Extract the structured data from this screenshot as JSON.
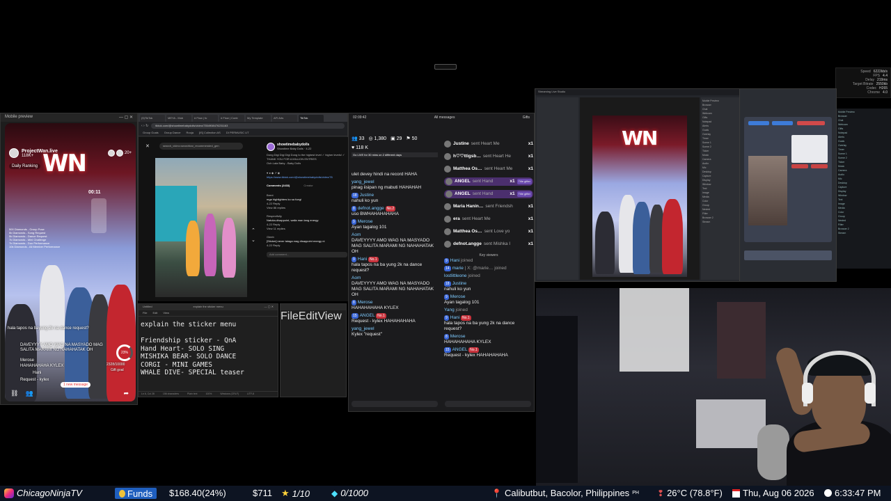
{
  "stats": {
    "rows": [
      {
        "label": "Speed",
        "value": "6222kb/s"
      },
      {
        "label": "FPS",
        "value": "4.4"
      },
      {
        "label": "Delay",
        "value": "219ms"
      },
      {
        "label": "Target Bitrate",
        "value": "2550kb"
      },
      {
        "label": "Codec",
        "value": "H265"
      },
      {
        "label": "Chrome",
        "value": "4.0"
      }
    ]
  },
  "mobile": {
    "title": "Mobile preview",
    "host_name": "ProjectWan.live",
    "host_likes": "118K+",
    "viewer_count": "20+",
    "daily_ranking": "Daily Ranking",
    "logo": "WN",
    "timer": "00:11",
    "goals": [
      "500 Diamonds - Group Pose",
      "5k Diamonds - Song Request",
      "5k Diamonds - Dance Request",
      "7k Diamonds - Mini Challenge",
      "7k Diamonds - Duo Performance",
      "10k Diamonds - All Member Performance"
    ],
    "comment_top": "hala tapos na bayung 2k na dance request?",
    "comment_1": "DAVEYYYY AMO WAG NA MASYADO MAG SALITA MARAMI NG NAHAHATAK OH",
    "comment_2_user": "Merose",
    "comment_2": "HAHAHAHAHA KYLEX",
    "comment_3_user": "Hani",
    "comment_3": "Request - kylex",
    "goal_percent": "23%",
    "goal_count": "2328",
    "goal_total": "/10000",
    "gift_goal": "Gift goal",
    "new_message": "1 new message"
  },
  "browser": {
    "tabs": [
      "(5)TikTok",
      "MEYA - Mob",
      "# Flow | fo",
      "# Flow | Contr",
      "My Template",
      "AFI Arts",
      "TikTok"
    ],
    "url": "tiktok.com/@showtimebabydolls/video/7354908476231163",
    "bookmarks": [
      "Group Goals",
      "Group Dance",
      "Rooja",
      "[IS] Collection AS",
      "DI PERMUSIC UT"
    ],
    "search": "search_video=searchbar_recommended_gen",
    "author": "showtimebabydolls",
    "author_sub": "Showtime Baby Dolls · 4-22",
    "caption": "Dong Digi Digi Digi Dong to the highest level ✓ higher levels! ✓ THANK YOU FOR A MILLION ENTRIES",
    "sound": "Ooh Lala Baby - Baby Dolls",
    "link": "https://www.tiktok.com/@showtimebabydolls/video/76",
    "comments_header": "Comments (2433)",
    "creator_tab": "Creator",
    "c1_user": "Brent",
    "c1_text": "mga highlighters ko sa fuegi",
    "c1_meta": "4-22 Reply",
    "c1_more": "View 86 replies",
    "c2_user": "Respectfully",
    "c2_text": "Natuka-disappoint, walla man lang energy",
    "c2_meta": "4-22 Reply",
    "c2_more": "View 11 replies",
    "c3_user": "Gleeb",
    "c3_text": "[Sticker] never talaga mag disappoint energy ni",
    "c3_meta": "4-22 Reply",
    "add_comment": "Add comment..."
  },
  "notepad": {
    "title": "Untitled",
    "tab": "explain the sticker menu",
    "menu": [
      "File",
      "Edit",
      "View"
    ],
    "lines": [
      "explain the sticker menu",
      "",
      "Friendship sticker - QnA",
      "Hand Heart- SOLO SING",
      "MISHIKA BEAR- SOLO DANCE",
      "CORGI - MINI GAMES",
      "WHALE DIVE- SPECIAL teaser"
    ],
    "status": [
      "Ln 6, Col 28",
      "156 characters",
      "Plain text",
      "100%",
      "Windows (CRLF)",
      "UTF-8"
    ]
  },
  "chat": {
    "clock": "02:09:42",
    "all_messages": "All messages",
    "gifts": "Gifts",
    "viewers": "33",
    "coins": "1,380",
    "shares": "29",
    "gifters": "50",
    "likes": "118 K",
    "live_banner": "Go LIVE for 30 mins on 2 different days",
    "left_messages": [
      {
        "user": "",
        "text": "ulet devey hindi na record HAHA"
      },
      {
        "user": "yang_jewel",
        "text": "pinag iisipan ng mabuti HAHAHAH"
      },
      {
        "user": "Justine",
        "lvl": "18",
        "text": "nahuli ko yun"
      },
      {
        "user": "defnot.angge",
        "lvl": "8",
        "badge": "No.2",
        "text": "uso BWHAHAHAHAHA"
      },
      {
        "user": "Merose",
        "lvl": "9",
        "text": "Ayan tagalog 101"
      },
      {
        "user": "Aom",
        "text": "DAVEYYYY AMO WAG NA MASYADO MAG SALITA MARAMI NG NAHAHATAK OH"
      },
      {
        "user": "Hani",
        "lvl": "9",
        "badge": "No.1",
        "text": "hala tapos na ba yung 2k na dance request?"
      },
      {
        "user": "Aom",
        "text": "DAVEYYYY AMO WAG NA MASYADO MAG SALITA MARAMI NG NAHAHATAK OH"
      },
      {
        "user": "Merose",
        "lvl": "8",
        "text": "HAHAHAHAHA KYLEX"
      },
      {
        "user": "ANGEL",
        "lvl": "15",
        "badge": "No.1",
        "text": "Request - kylex HAHAHAHAHA"
      },
      {
        "user": "yang_jewel",
        "text": "Kylex \"request\""
      }
    ],
    "gift_rows": [
      {
        "name": "Justine",
        "text": "sent Heart Me",
        "x": "x1",
        "hl": false
      },
      {
        "name": "h♡♡ttigsb…",
        "text": "sent Heart He",
        "x": "x1",
        "hl": false
      },
      {
        "name": "Matthea Os…",
        "text": "sent Heart Me",
        "x": "x1",
        "hl": false
      },
      {
        "name": "ANGEL",
        "text": "sent Hand",
        "x": "x1",
        "hl": true,
        "tag": "Title gifter"
      },
      {
        "name": "ANGEL",
        "text": "sent Hand",
        "x": "x1",
        "hl": true,
        "tag": "Title gifter"
      },
      {
        "name": "Maria Hanin…",
        "text": "sent Friendsh",
        "x": "x1",
        "hl": false
      },
      {
        "name": "era",
        "text": "sent Heart Me",
        "x": "x1",
        "hl": false
      },
      {
        "name": "Matthea Os…",
        "text": "sent Love yo",
        "x": "x1",
        "hl": false
      },
      {
        "name": "defnot.angge",
        "text": "sent Mishka I",
        "x": "x1",
        "hl": false
      }
    ],
    "key_viewers": "Key viewers",
    "right_messages": [
      {
        "user": "Hani",
        "lvl": "9",
        "text": "joined",
        "sys": true
      },
      {
        "user": "marie",
        "lvl": "14",
        "text": "| X: @marie… joined",
        "sys": true
      },
      {
        "user": "lostlittleone",
        "text": "joined",
        "sys": true
      },
      {
        "user": "Justine",
        "lvl": "18",
        "text": "nahuli ko yun"
      },
      {
        "user": "Merose",
        "lvl": "9",
        "text": "Ayan tagalog 101"
      },
      {
        "user": "Yang",
        "text": "joined",
        "sys": true
      },
      {
        "user": "Hani",
        "lvl": "9",
        "badge": "No.1",
        "text": "hala tapos na ba yung 2k na dance request?"
      },
      {
        "user": "Merose",
        "lvl": "8",
        "text": "HAHAHAHAHA KYLEX"
      },
      {
        "user": "ANGEL",
        "lvl": "15",
        "badge": "No.1",
        "text": "Request - kylex HAHAHAHAHA"
      }
    ]
  },
  "obs": {
    "title": "Streaming Live Studio",
    "sources": [
      "Mobile Preview",
      "Browser",
      "Chat",
      "Webcam",
      "Gifts",
      "Notepad",
      "Alerts",
      "Goals",
      "Overlay",
      "Timer",
      "Scene 1",
      "Scene 2",
      "Ticker",
      "Music",
      "Camera",
      "Audio",
      "Mic",
      "Desktop",
      "Capture",
      "Display",
      "Window",
      "Text",
      "Image",
      "Media",
      "Color",
      "Group",
      "Nested",
      "Filter",
      "Browser 2",
      "Stream"
    ],
    "logo": "WN"
  },
  "ticker": {
    "handle": "ChicagoNinjaTV",
    "funds_label": "Funds",
    "funds_value": "$168.40(24%)",
    "coins": "$711",
    "stars": "1/10",
    "diamonds": "0/1000",
    "location": "Calibutbut, Bacolor, Philippines",
    "country": "PH",
    "temperature": "26°C (78.8°F)",
    "date": "Thu, Aug 06 2026",
    "time": "6:33:47 PM"
  }
}
